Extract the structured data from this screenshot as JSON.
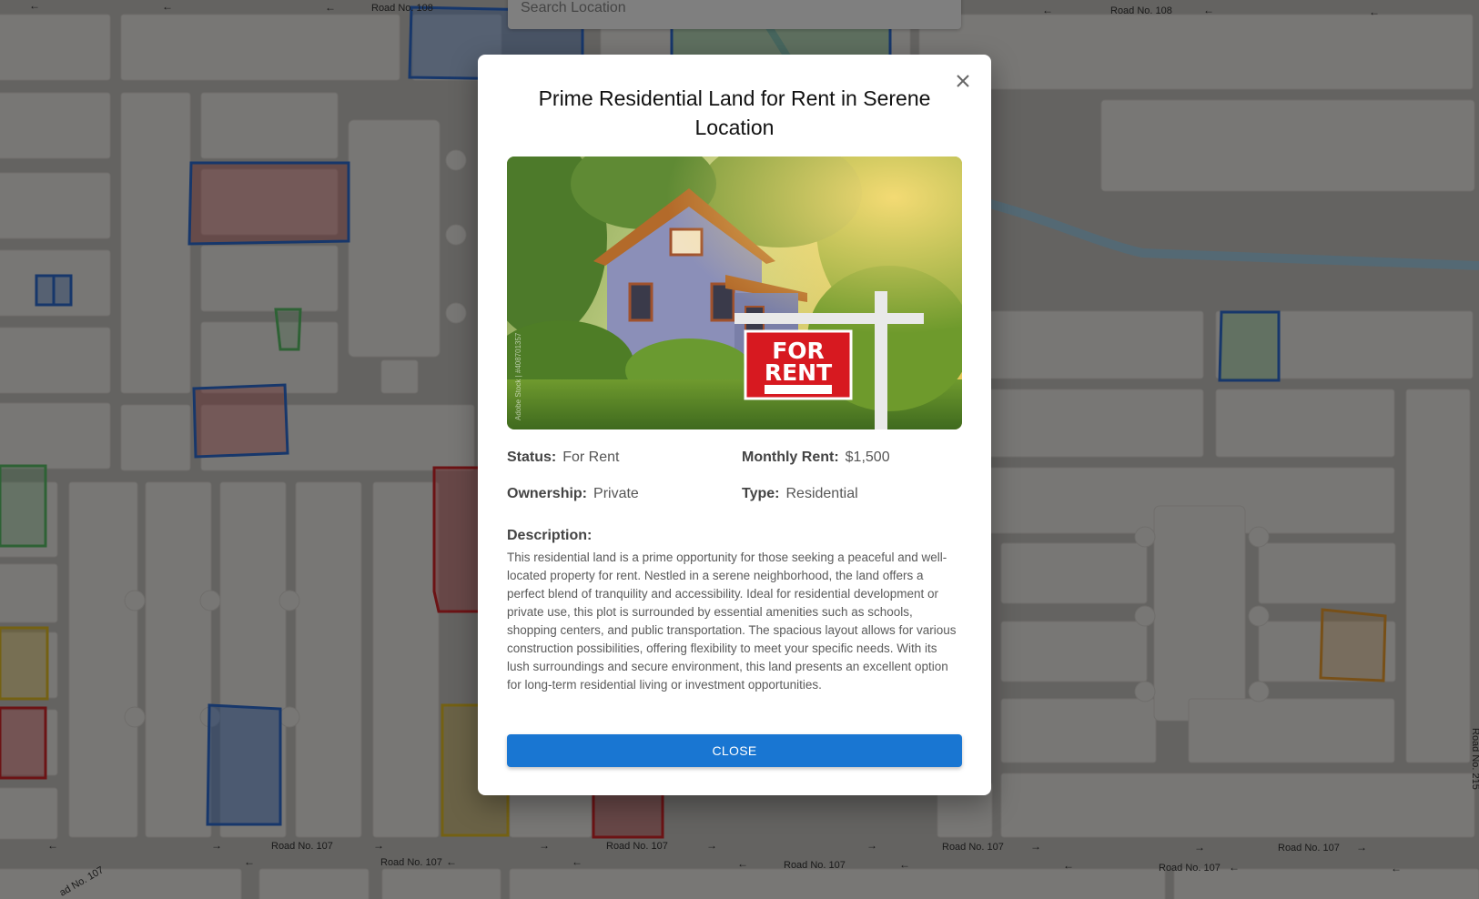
{
  "search": {
    "placeholder": "Search Location"
  },
  "map": {
    "road_labels": [
      "Road No. 108",
      "Road No. 108",
      "Road No. 107",
      "Road No. 107",
      "Road No. 107",
      "Road No. 107",
      "Road No. 107",
      "Road No. 107",
      "Road No. 107",
      "Road No. 107",
      "ad No. 107",
      "Road No. 215"
    ],
    "parcel_colors": {
      "blue": "#2f6fd6",
      "red": "#d8262b",
      "green": "#5cc46a",
      "yellow": "#e8c227",
      "orange": "#f0a030"
    },
    "road_color": "#c9c7c3",
    "block_color": "#f1efeb",
    "water_color": "#a9d2e8"
  },
  "modal": {
    "title": "Prime Residential Land for Rent in Serene Location",
    "image": {
      "sign_line1": "FOR",
      "sign_line2": "RENT",
      "watermark": "Adobe Stock | #408701357"
    },
    "fields": {
      "status_label": "Status:",
      "status_value": "For Rent",
      "rent_label": "Monthly Rent:",
      "rent_value": "$1,500",
      "ownership_label": "Ownership:",
      "ownership_value": "Private",
      "type_label": "Type:",
      "type_value": "Residential"
    },
    "description_label": "Description:",
    "description": "This residential land is a prime opportunity for those seeking a peaceful and well-located property for rent. Nestled in a serene neighborhood, the land offers a perfect blend of tranquility and accessibility. Ideal for residential development or private use, this plot is surrounded by essential amenities such as schools, shopping centers, and public transportation. The spacious layout allows for various construction possibilities, offering flexibility to meet your specific needs. With its lush surroundings and secure environment, this land presents an excellent option for long-term residential living or investment opportunities.",
    "close_button": "CLOSE",
    "accent_color": "#1976d2"
  }
}
